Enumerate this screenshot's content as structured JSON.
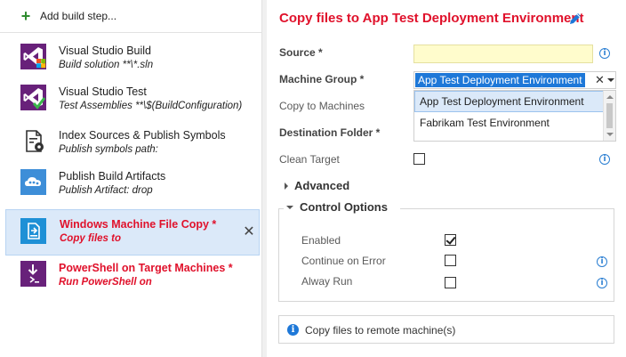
{
  "left_pane": {
    "add_build_step": "Add build step...",
    "tasks": [
      {
        "name": "Visual Studio Build",
        "subtitle": "Build solution **\\*.sln",
        "icon": "visual-studio-icon"
      },
      {
        "name": "Visual Studio Test",
        "subtitle": "Test Assemblies **\\$(BuildConfiguration)",
        "icon": "visual-studio-test-icon"
      },
      {
        "name": "Index Sources & Publish Symbols",
        "subtitle": "Publish symbols path:",
        "icon": "document-gear-icon"
      },
      {
        "name": "Publish Build Artifacts",
        "subtitle": "Publish Artifact: drop",
        "icon": "artifacts-cloud-icon"
      },
      {
        "name": "Windows Machine File Copy *",
        "subtitle": "Copy files to",
        "icon": "file-copy-icon",
        "selected": true,
        "invalid": true
      },
      {
        "name": "PowerShell on Target Machines *",
        "subtitle": "Run PowerShell on",
        "icon": "powershell-icon",
        "invalid": true
      }
    ],
    "remove_symbol": "✕"
  },
  "detail": {
    "title": "Copy files to App Test Deployment Environment",
    "fields": {
      "source_label": "Source *",
      "source_value": "",
      "machine_group_label": "Machine Group *",
      "machine_group_value": "App Test Deployment Environment",
      "machine_group_clear": "✕",
      "machine_group_options": [
        "App Test Deployment Environment",
        "Fabrikam Test Environment"
      ],
      "copy_to_machines_label": "Copy to Machines",
      "destination_folder_label": "Destination Folder *",
      "clean_target_label": "Clean Target",
      "clean_target_checked": false
    },
    "advanced_label": "Advanced",
    "control_options": {
      "label": "Control Options",
      "enabled_label": "Enabled",
      "enabled_checked": true,
      "continue_on_error_label": "Continue on Error",
      "continue_on_error_checked": false,
      "always_run_label": "Alway Run",
      "always_run_checked": false
    },
    "info_message": "Copy files to remote machine(s)"
  },
  "colors": {
    "accent_blue": "#1e78d8",
    "error_red": "#e0112b",
    "selected_bg": "#dbe9f9",
    "required_input_bg": "#fffccc",
    "add_green": "#2e8b2e",
    "vs_purple": "#68217a"
  }
}
